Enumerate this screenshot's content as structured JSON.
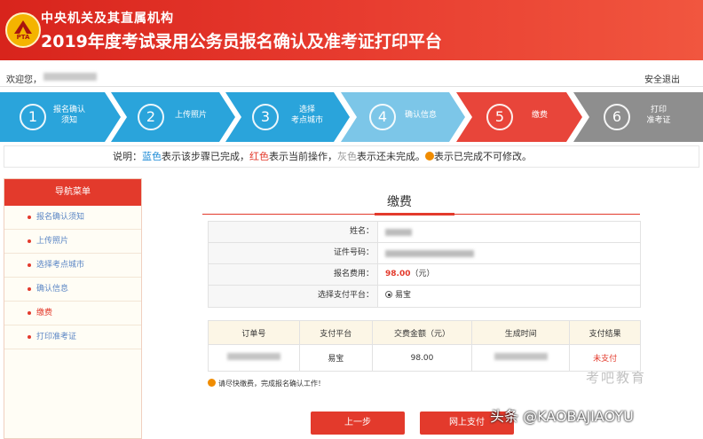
{
  "header": {
    "logo_text": "PTA",
    "org": "中央机关及其直属机构",
    "title": "2019年度考试录用公务员报名确认及准考证打印平台",
    "bg_color": "#e33a2c"
  },
  "welcome": {
    "label": "欢迎您，",
    "logout": "安全退出"
  },
  "steps": [
    {
      "number": "1",
      "label": "报名确认\n须知",
      "status": "done",
      "color": "#2aa4db"
    },
    {
      "number": "2",
      "label": "上传照片",
      "status": "done",
      "color": "#2aa4db"
    },
    {
      "number": "3",
      "label": "选择\n考点城市",
      "status": "done",
      "color": "#2aa4db"
    },
    {
      "number": "4",
      "label": "确认信息",
      "status": "done",
      "color": "#7cc6e8"
    },
    {
      "number": "5",
      "label": "缴费",
      "status": "current",
      "color": "#e8453a"
    },
    {
      "number": "6",
      "label": "打印\n准考证",
      "status": "todo",
      "color": "#8e8e8e"
    }
  ],
  "legend": {
    "prefix": "说明：",
    "blue": "蓝色",
    "t1": "表示该步骤已完成，",
    "red": "红色",
    "t2": "表示当前操作，",
    "gray": "灰色",
    "t3": "表示还未完成。",
    "t4": "表示已完成不可修改。"
  },
  "sidebar": {
    "heading": "导航菜单",
    "items": [
      {
        "label": "报名确认须知"
      },
      {
        "label": "上传照片"
      },
      {
        "label": "选择考点城市"
      },
      {
        "label": "确认信息"
      },
      {
        "label": "缴费"
      },
      {
        "label": "打印准考证"
      }
    ]
  },
  "main": {
    "title": "缴费",
    "info": {
      "name_label": "姓名：",
      "id_label": "证件号码：",
      "fee_label": "报名费用：",
      "fee_value": "98.00",
      "fee_unit": "（元）",
      "platform_label": "选择支付平台：",
      "platform_value": "易宝"
    },
    "orders": {
      "headers": [
        "订单号",
        "支付平台",
        "交费金额（元）",
        "生成时间",
        "支付结果"
      ],
      "row": {
        "platform": "易宝",
        "amount": "98.00",
        "result": "未支付"
      }
    },
    "notice": "请尽快缴费，完成报名确认工作！",
    "prev_button": "上一步",
    "pay_button": "网上支付"
  },
  "watermarks": {
    "brand": "考吧教育",
    "toutiao": "头条 @KAOBAJIAOYU"
  }
}
